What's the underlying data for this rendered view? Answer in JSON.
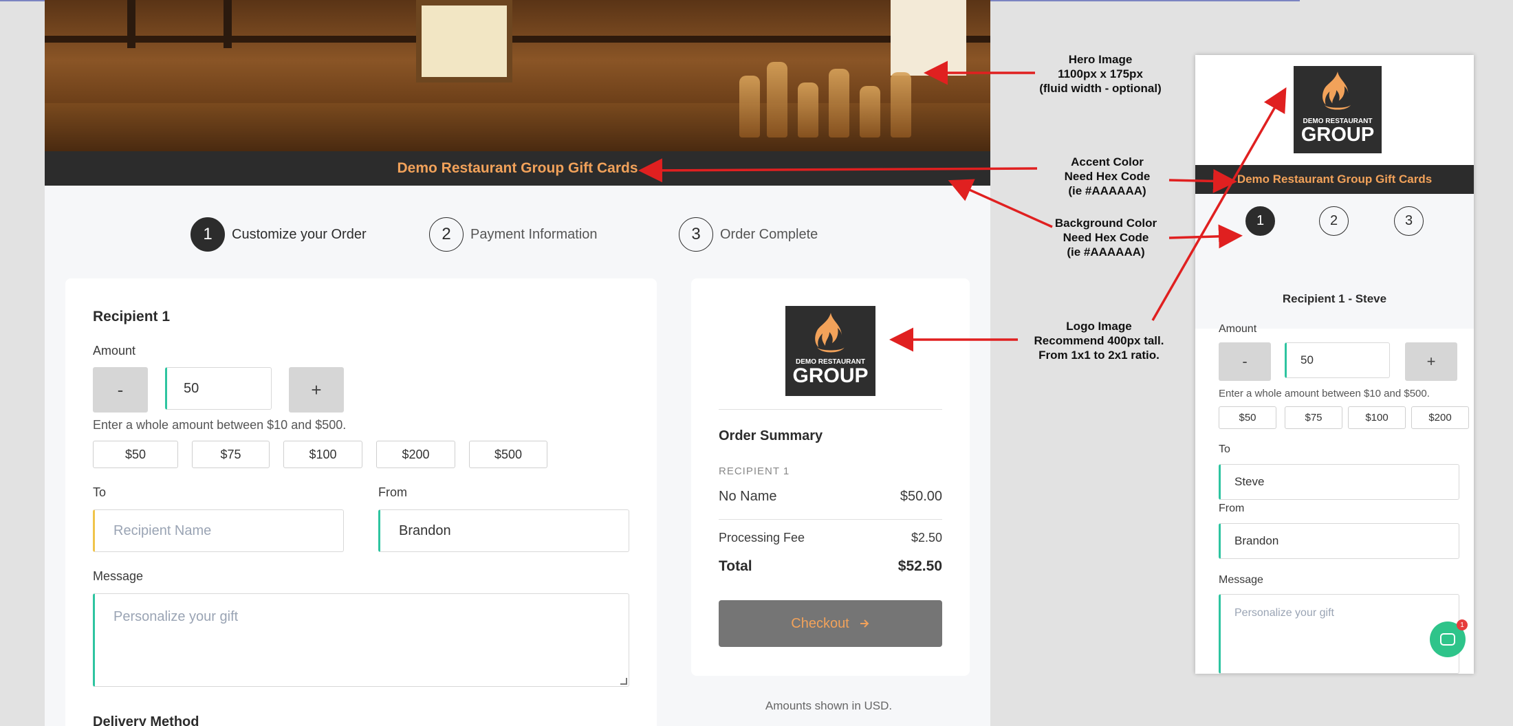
{
  "hero": {
    "banner_title": "Demo Restaurant Group Gift Cards"
  },
  "steps": [
    {
      "number": "1",
      "label": "Customize your Order"
    },
    {
      "number": "2",
      "label": "Payment Information"
    },
    {
      "number": "3",
      "label": "Order Complete"
    }
  ],
  "form": {
    "recipient_heading": "Recipient 1",
    "amount_label": "Amount",
    "decrement": "-",
    "increment": "+",
    "amount_value": "50",
    "amount_hint": "Enter a whole amount between $10 and $500.",
    "presets": [
      "$50",
      "$75",
      "$100",
      "$200",
      "$500"
    ],
    "to_label": "To",
    "to_placeholder": "Recipient Name",
    "from_label": "From",
    "from_value": "Brandon",
    "message_label": "Message",
    "message_placeholder": "Personalize your gift",
    "delivery_label": "Delivery Method"
  },
  "logo": {
    "line1": "DEMO RESTAURANT",
    "line2": "GROUP"
  },
  "summary": {
    "title": "Order Summary",
    "recipient_caption": "RECIPIENT 1",
    "recipient_name": "No Name",
    "recipient_amount": "$50.00",
    "fee_label": "Processing Fee",
    "fee_amount": "$2.50",
    "total_label": "Total",
    "total_amount": "$52.50",
    "checkout_label": "Checkout",
    "currency_note": "Amounts shown in USD."
  },
  "annotations": {
    "hero_image": [
      "Hero Image",
      "1100px x 175px",
      "(fluid width - optional)"
    ],
    "accent_color": [
      "Accent Color",
      "Need Hex Code",
      "(ie #AAAAAA)"
    ],
    "background_color": [
      "Background Color",
      "Need Hex Code",
      "(ie #AAAAAA)"
    ],
    "logo_image": [
      "Logo Image",
      "Recommend 400px tall.",
      "From 1x1 to 2x1 ratio."
    ]
  },
  "mobile": {
    "banner_title": "Demo Restaurant Group Gift Cards",
    "steps": [
      "1",
      "2",
      "3"
    ],
    "recipient_title": "Recipient 1 - Steve",
    "amount_label": "Amount",
    "decrement": "-",
    "increment": "+",
    "amount_value": "50",
    "amount_hint": "Enter a whole amount between $10 and $500.",
    "presets": [
      "$50",
      "$75",
      "$100",
      "$200"
    ],
    "to_label": "To",
    "to_value": "Steve",
    "from_label": "From",
    "from_value": "Brandon",
    "message_label": "Message",
    "message_placeholder": "Personalize your gift",
    "chat_badge": "1"
  },
  "colors": {
    "accent": "#F2A25A",
    "dark_bar": "#2C2C2C",
    "background": "#F6F7F9",
    "focus": "#2EC4A0",
    "arrow": "#E02020"
  }
}
